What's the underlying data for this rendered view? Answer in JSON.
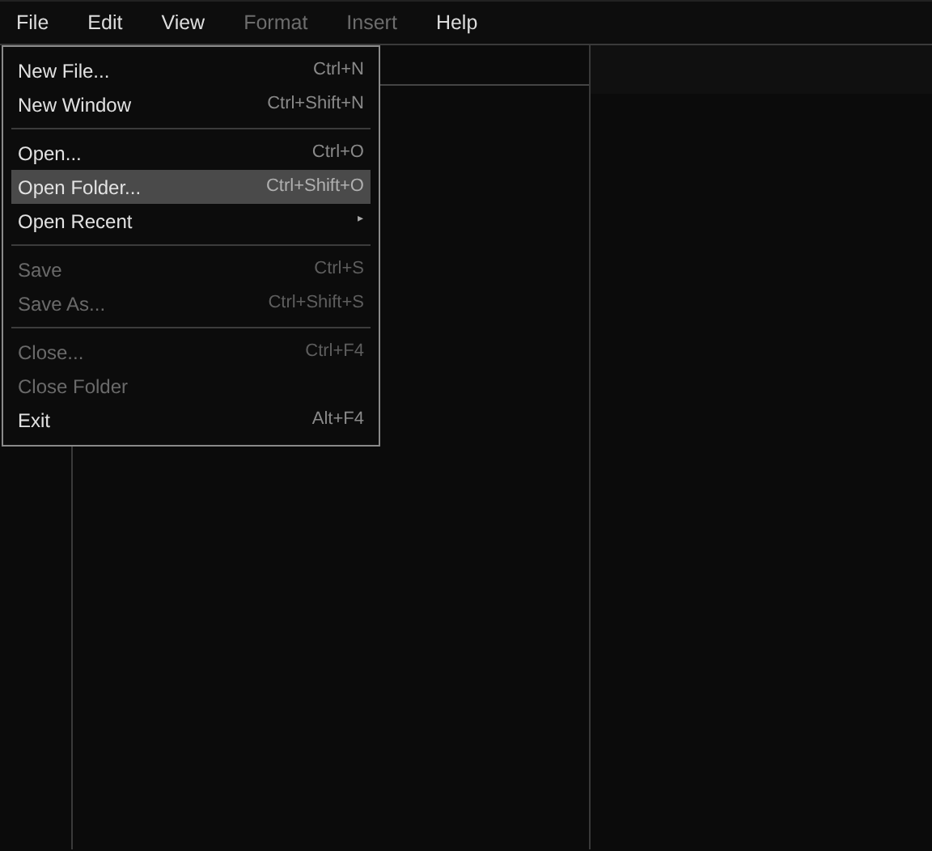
{
  "menubar": [
    {
      "label": "File",
      "disabled": false
    },
    {
      "label": "Edit",
      "disabled": false
    },
    {
      "label": "View",
      "disabled": false
    },
    {
      "label": "Format",
      "disabled": true
    },
    {
      "label": "Insert",
      "disabled": true
    },
    {
      "label": "Help",
      "disabled": false
    }
  ],
  "file_menu": [
    {
      "kind": "item",
      "label": "New File...",
      "shortcut": "Ctrl+N",
      "disabled": false,
      "selected": false
    },
    {
      "kind": "item",
      "label": "New Window",
      "shortcut": "Ctrl+Shift+N",
      "disabled": false,
      "selected": false
    },
    {
      "kind": "separator"
    },
    {
      "kind": "item",
      "label": "Open...",
      "shortcut": "Ctrl+O",
      "disabled": false,
      "selected": false
    },
    {
      "kind": "item",
      "label": "Open Folder...",
      "shortcut": "Ctrl+Shift+O",
      "disabled": false,
      "selected": true
    },
    {
      "kind": "submenu",
      "label": "Open Recent",
      "arrow": "▸",
      "disabled": false,
      "selected": false
    },
    {
      "kind": "separator"
    },
    {
      "kind": "item",
      "label": "Save",
      "shortcut": "Ctrl+S",
      "disabled": true,
      "selected": false
    },
    {
      "kind": "item",
      "label": "Save As...",
      "shortcut": "Ctrl+Shift+S",
      "disabled": true,
      "selected": false
    },
    {
      "kind": "separator"
    },
    {
      "kind": "item",
      "label": "Close...",
      "shortcut": "Ctrl+F4",
      "disabled": true,
      "selected": false
    },
    {
      "kind": "item",
      "label": "Close Folder",
      "disabled": true,
      "selected": false
    },
    {
      "kind": "item",
      "label": "Exit",
      "shortcut": "Alt+F4",
      "disabled": false,
      "selected": false
    }
  ]
}
